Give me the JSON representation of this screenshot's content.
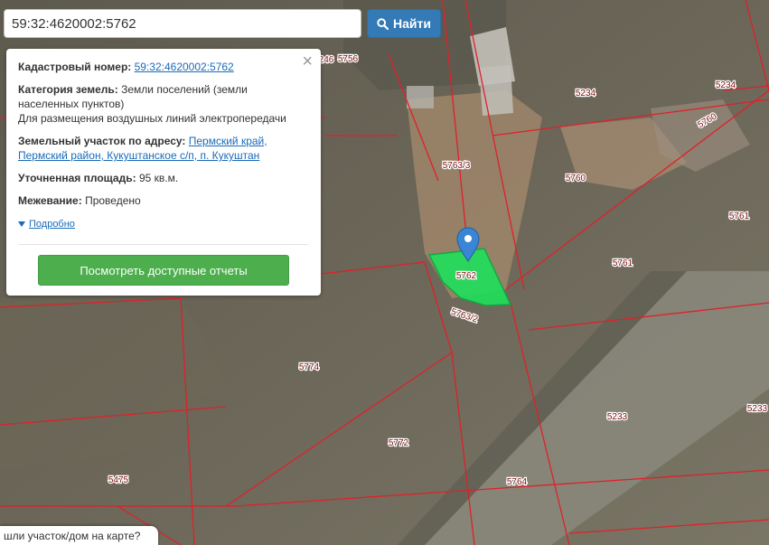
{
  "search": {
    "value": "59:32:4620002:5762",
    "button_label": "Найти"
  },
  "info": {
    "cadastral_label": "Кадастровый номер:",
    "cadastral_value": "59:32:4620002:5762",
    "category_label": "Категория земель:",
    "category_value": "Земли поселений (земли населенных пунктов)",
    "category_purpose": "Для размещения воздушных линий электропередачи",
    "address_label": "Земельный участок по адресу:",
    "address_value": "Пермский край, Пермский район, Кукуштанское с/п, п. Кукуштан",
    "area_label": "Уточненная площадь:",
    "area_value": "95 кв.м.",
    "survey_label": "Межевание:",
    "survey_value": "Проведено",
    "more_link": "Подробно",
    "report_button": "Посмотреть доступные отчеты",
    "close_symbol": "×"
  },
  "bottom_tab": {
    "label": "шли участок/дом на карте?"
  },
  "map": {
    "parcel_labels": [
      "5762",
      "5763/3",
      "5763/2",
      "5774",
      "5772",
      "5475",
      "5764",
      "5233",
      "5233",
      "5761",
      "5761",
      "5760",
      "5760",
      "5234",
      "5234",
      "5756",
      "246"
    ],
    "selected_parcel": "5762",
    "boundary_color": "#e0202a",
    "selected_fill": "#1fe05a",
    "marker_color": "#3a86d4"
  }
}
